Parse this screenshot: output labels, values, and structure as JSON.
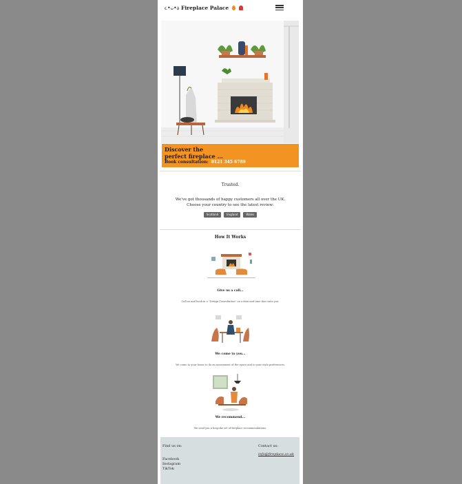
{
  "header": {
    "logo_face": "૮•ᴗ•ა",
    "logo_text": "Fireplace Palace"
  },
  "icons": {
    "flame": "flame-icon",
    "person": "person-icon",
    "menu": "hamburger-menu-icon"
  },
  "promo": {
    "heading_line1": "Discover the",
    "heading_line2": "perfect fireplace ...",
    "book_label": "Book consultation:",
    "phone": "0121 345 6789"
  },
  "trusted": {
    "title": "Trusted.",
    "line1": "We've got thousands of happy customers all over the UK.",
    "line2": "Choose your country to see the latest review:",
    "countries": [
      "Scotland",
      "England",
      "Wales"
    ]
  },
  "how": {
    "title": "How It Works",
    "steps": [
      {
        "title": "Give us a call...",
        "text": "Call us and book in a \"Design Consultation\" on a date and time that suits you."
      },
      {
        "title": "We come to you...",
        "text": "We come to your home to do an assessment of the space and to your style preferences."
      },
      {
        "title": "We recommend...",
        "text": "We send you a bespoke set of fireplace recommendations."
      }
    ]
  },
  "footer": {
    "find_us": "Find us on:",
    "links": [
      "Facebook",
      "Instagram",
      "TikTok"
    ],
    "contact": "Contact us:",
    "email": "info@fireplace.co.uk"
  },
  "colors": {
    "accent": "#f39422",
    "background": "#8a8a8a",
    "footer": "#d7dedf"
  }
}
